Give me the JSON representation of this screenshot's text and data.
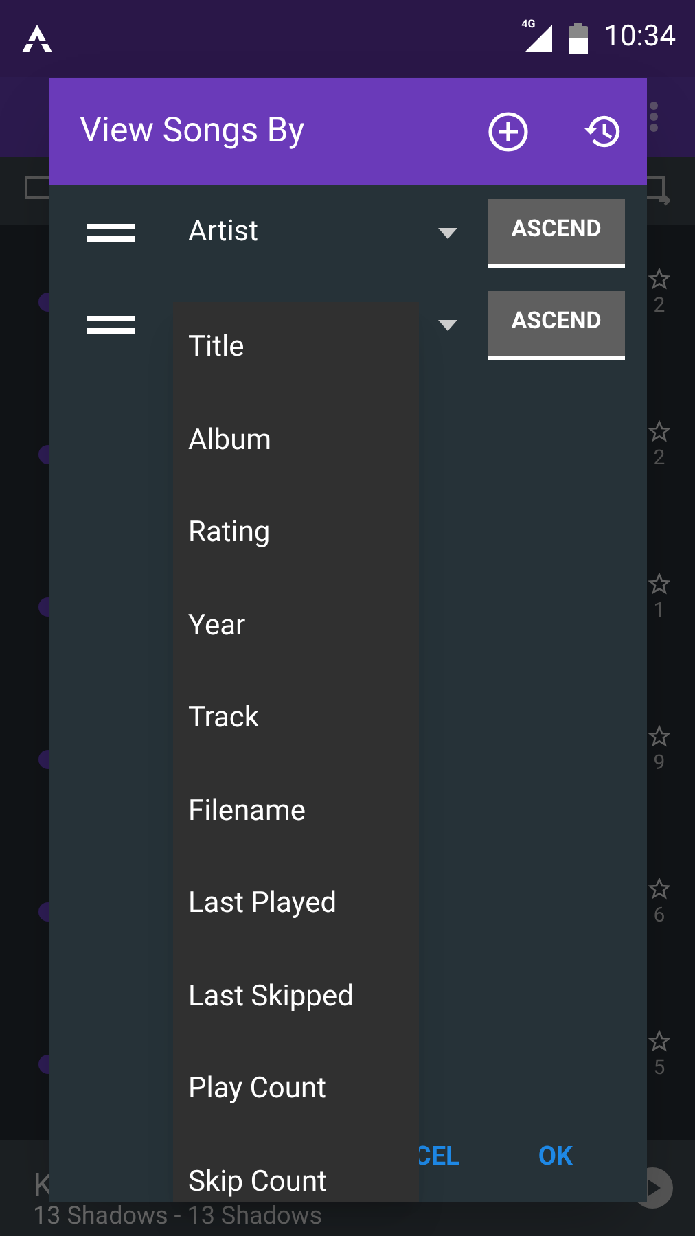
{
  "status_bar": {
    "network": "4G",
    "time": "10:34"
  },
  "background_list": {
    "rows": [
      {
        "count": "2"
      },
      {
        "count": "2"
      },
      {
        "count": "1"
      },
      {
        "count": "9"
      },
      {
        "count": "6"
      },
      {
        "count": "5"
      }
    ]
  },
  "now_playing": {
    "title": "K",
    "subtitle": "13 Shadows - 13 Shadows"
  },
  "dialog": {
    "title": "View Songs By",
    "sort_rows": [
      {
        "field": "Artist",
        "order": "ASCEND"
      },
      {
        "order": "ASCEND"
      }
    ],
    "dropdown": {
      "items": [
        "Title",
        "Album",
        "Rating",
        "Year",
        "Track",
        "Filename",
        "Last Played",
        "Last Skipped",
        "Play Count",
        "Skip Count"
      ]
    },
    "buttons": [
      {
        "label": "CEL"
      },
      {
        "label": "OK"
      }
    ]
  }
}
